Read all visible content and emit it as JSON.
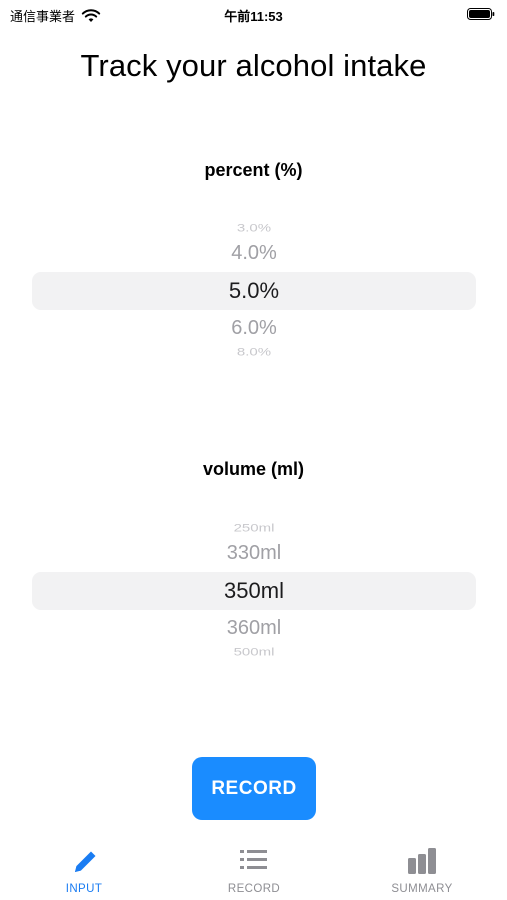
{
  "status_bar": {
    "carrier": "通信事業者",
    "time": "午前11:53"
  },
  "title": "Track your alcohol intake",
  "percent_picker": {
    "label": "percent (%)",
    "options": [
      "3.0%",
      "4.0%",
      "5.0%",
      "6.0%",
      "8.0%"
    ],
    "selected": "5.0%"
  },
  "volume_picker": {
    "label": "volume (ml)",
    "options": [
      "250ml",
      "330ml",
      "350ml",
      "360ml",
      "500ml"
    ],
    "selected": "350ml"
  },
  "record_button": {
    "label": "RECORD"
  },
  "tab_bar": {
    "tabs": [
      {
        "label": "INPUT",
        "icon": "pencil-icon",
        "active": true
      },
      {
        "label": "RECORD",
        "icon": "list-icon",
        "active": false
      },
      {
        "label": "SUMMARY",
        "icon": "bar-chart-icon",
        "active": false
      }
    ]
  },
  "colors": {
    "accent": "#1a8cff",
    "active_tab": "#1a7cf2",
    "inactive_tab": "#8e8e93",
    "picker_highlight": "#f2f2f3"
  }
}
